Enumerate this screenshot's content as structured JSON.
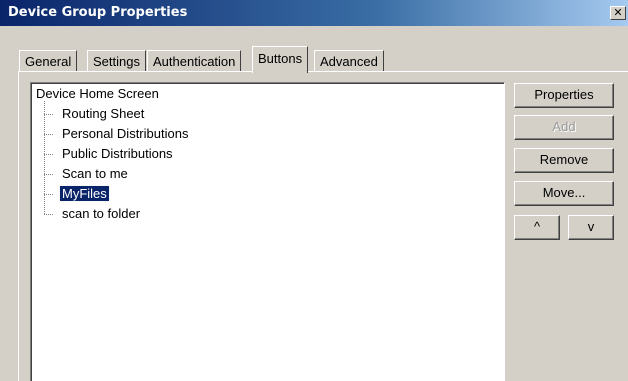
{
  "window": {
    "title": "Device Group Properties",
    "close_label": "✕"
  },
  "tabs": [
    {
      "label": "General",
      "active": false
    },
    {
      "label": "Settings",
      "active": false
    },
    {
      "label": "Authentication",
      "active": false
    },
    {
      "label": "Buttons",
      "active": true
    },
    {
      "label": "Advanced",
      "active": false
    }
  ],
  "tree": {
    "root": "Device Home Screen",
    "items": [
      {
        "label": "Routing Sheet",
        "selected": false
      },
      {
        "label": "Personal Distributions",
        "selected": false
      },
      {
        "label": "Public Distributions",
        "selected": false
      },
      {
        "label": "Scan to me",
        "selected": false
      },
      {
        "label": "MyFiles",
        "selected": true
      },
      {
        "label": "scan to folder",
        "selected": false
      }
    ]
  },
  "buttons": {
    "properties": "Properties",
    "add": "Add",
    "add_enabled": false,
    "remove": "Remove",
    "move": "Move...",
    "move_up": "^",
    "move_down": "v"
  }
}
